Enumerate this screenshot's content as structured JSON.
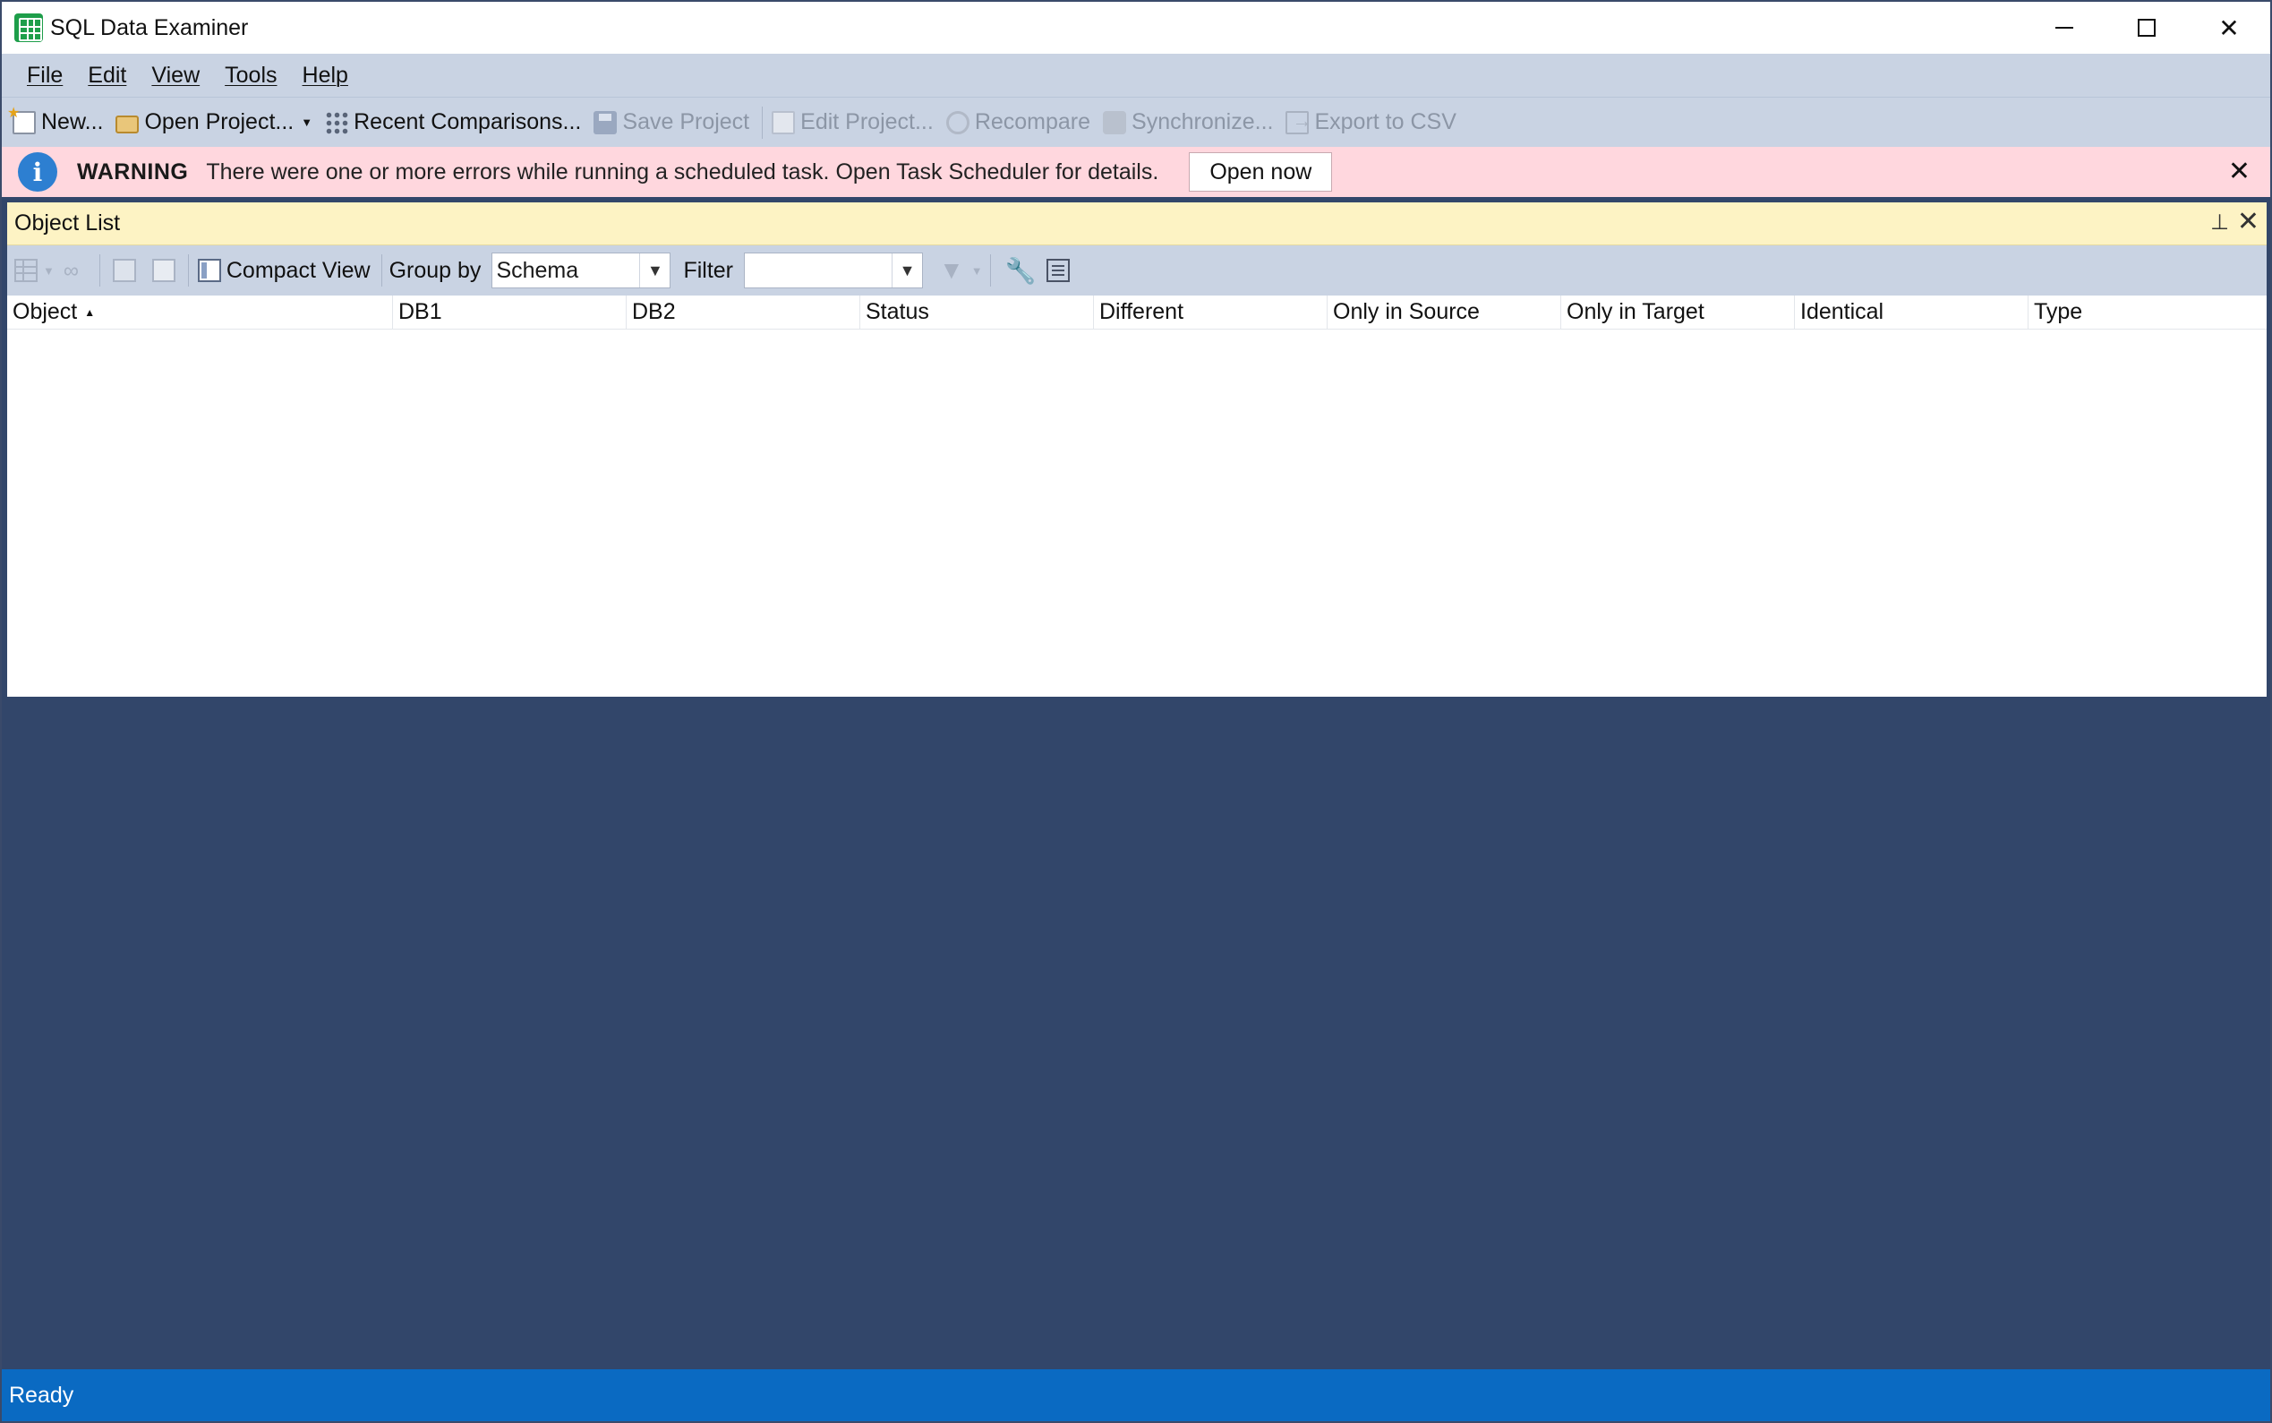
{
  "window": {
    "title": "SQL Data Examiner",
    "controls": {
      "minimize": "",
      "maximize": "",
      "close": "✕"
    }
  },
  "menu": {
    "items": [
      {
        "label": "File"
      },
      {
        "label": "Edit"
      },
      {
        "label": "View"
      },
      {
        "label": "Tools"
      },
      {
        "label": "Help"
      }
    ]
  },
  "toolbar": {
    "new_label": "New...",
    "open_project_label": "Open Project...",
    "recent_label": "Recent Comparisons...",
    "save_label": "Save Project",
    "edit_label": "Edit Project...",
    "recompare_label": "Recompare",
    "synchronize_label": "Synchronize...",
    "export_label": "Export to CSV"
  },
  "warning": {
    "title": "WARNING",
    "message": "There were one or more errors while running a scheduled task. Open Task Scheduler for details.",
    "button_label": "Open now",
    "close_glyph": "✕",
    "info_glyph": "i",
    "color": "#ffd7de"
  },
  "object_list": {
    "title": "Object List",
    "pin_glyph": "📌",
    "close_glyph": "✕",
    "toolbar": {
      "compact_view_label": "Compact View",
      "group_by_label": "Group by",
      "group_by_value": "Schema",
      "filter_label": "Filter",
      "filter_value": ""
    },
    "columns": [
      {
        "label": "Object",
        "sorted": "ascending"
      },
      {
        "label": "DB1"
      },
      {
        "label": "DB2"
      },
      {
        "label": "Status"
      },
      {
        "label": "Different"
      },
      {
        "label": "Only in Source"
      },
      {
        "label": "Only in Target"
      },
      {
        "label": "Identical"
      },
      {
        "label": "Type"
      }
    ],
    "rows": []
  },
  "status": {
    "text": "Ready",
    "color": "#0a6ac2"
  },
  "colors": {
    "chrome": "#c9d3e3",
    "workspace": "#32466a",
    "panel_header": "#fdf3c4"
  }
}
